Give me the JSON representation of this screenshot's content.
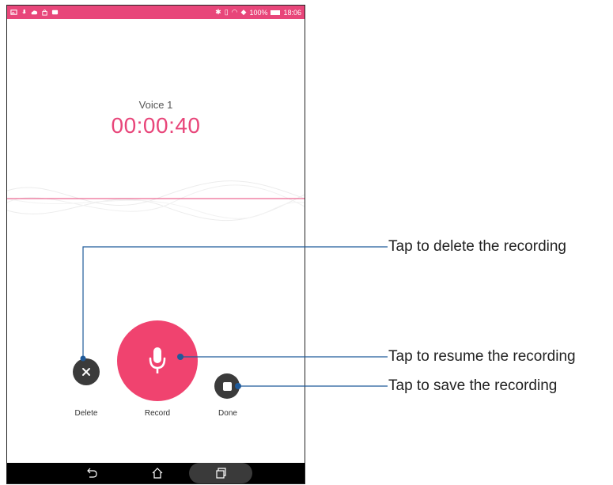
{
  "status_bar": {
    "battery": "100%",
    "time": "18:06"
  },
  "recorder": {
    "title": "Voice 1",
    "timer": "00:00:40"
  },
  "controls": {
    "delete_label": "Delete",
    "record_label": "Record",
    "done_label": "Done"
  },
  "annotations": {
    "delete": "Tap to delete the recording",
    "resume": "Tap to resume the recording",
    "save": "Tap to save the recording"
  },
  "colors": {
    "accent": "#e8467a",
    "dark_button": "#3b3b3b",
    "leader_line": "#1f5a9a"
  }
}
